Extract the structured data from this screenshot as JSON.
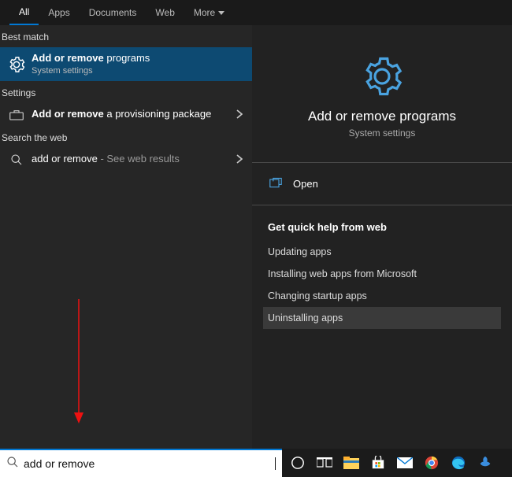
{
  "tabs": {
    "all": "All",
    "apps": "Apps",
    "documents": "Documents",
    "web": "Web",
    "more": "More"
  },
  "sections": {
    "best_match": "Best match",
    "settings": "Settings",
    "search_web": "Search the web"
  },
  "results": {
    "best": {
      "title_bold": "Add or remove",
      "title_rest": " programs",
      "subtitle": "System settings"
    },
    "setting1": {
      "title_bold": "Add or remove",
      "title_rest": " a provisioning package"
    },
    "web1": {
      "title_bold": "add or remove",
      "title_rest": " - See web results"
    }
  },
  "right": {
    "title": "Add or remove programs",
    "subtitle": "System settings",
    "open": "Open",
    "help_header": "Get quick help from web",
    "help_items": {
      "a": "Updating apps",
      "b": "Installing web apps from Microsoft",
      "c": "Changing startup apps",
      "d": "Uninstalling apps"
    }
  },
  "search": {
    "value": "add or remove"
  },
  "colors": {
    "accent": "#0078d4",
    "gear_blue": "#4aa3e0"
  }
}
